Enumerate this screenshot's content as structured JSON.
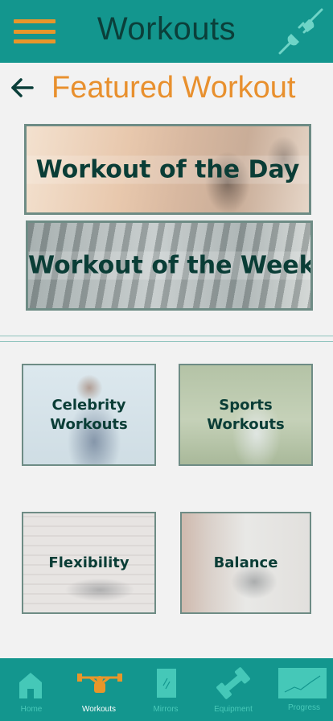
{
  "header": {
    "title": "Workouts",
    "menu_icon": "hamburger-menu-icon",
    "plug_icon": "plug-disconnect-icon",
    "accent_color": "#e8962a",
    "bar_color": "#13968e"
  },
  "featured": {
    "back_icon": "back-arrow-icon",
    "title": "Featured Workout",
    "banners": [
      {
        "label": "Workout of the Day"
      },
      {
        "label": "Workout of the Week"
      }
    ]
  },
  "categories": [
    {
      "line1": "Celebrity",
      "line2": "Workouts"
    },
    {
      "line1": "Sports",
      "line2": "Workouts"
    },
    {
      "line1": "Flexibility",
      "line2": ""
    },
    {
      "line1": "Balance",
      "line2": ""
    }
  ],
  "bottom_nav": {
    "active": "Workouts",
    "items": [
      {
        "label": "Home",
        "icon": "home-icon"
      },
      {
        "label": "Workouts",
        "icon": "weightlifter-icon"
      },
      {
        "label": "Mirrors",
        "icon": "mirror-icon"
      },
      {
        "label": "Equipment",
        "icon": "dumbbell-icon"
      },
      {
        "label": "Progress",
        "icon": "progress-chart-icon"
      }
    ]
  }
}
